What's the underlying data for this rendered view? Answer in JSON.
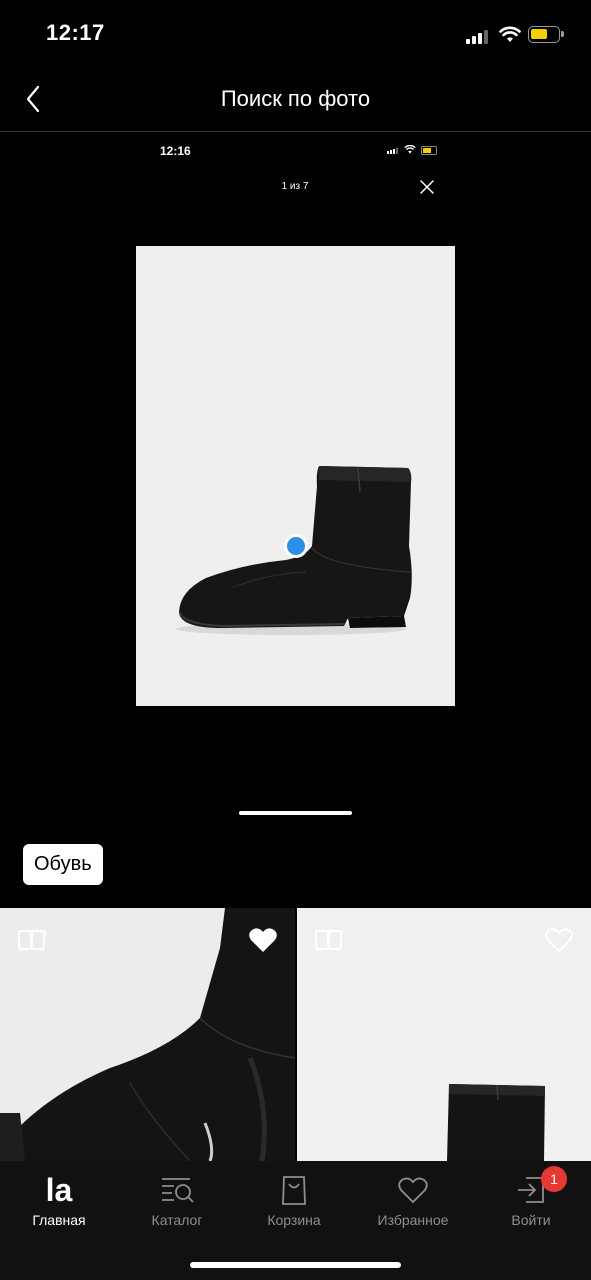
{
  "status_bar": {
    "time": "12:17"
  },
  "header": {
    "title": "Поиск по фото"
  },
  "inner_screen": {
    "time": "12:16",
    "counter": "1 из 7"
  },
  "category_chip": {
    "label": "Обувь"
  },
  "tabs": [
    {
      "label": "Главная",
      "icon": "logo-icon",
      "active": true
    },
    {
      "label": "Каталог",
      "icon": "catalog-search-icon",
      "active": false
    },
    {
      "label": "Корзина",
      "icon": "bag-icon",
      "active": false
    },
    {
      "label": "Избранное",
      "icon": "heart-icon",
      "active": false
    },
    {
      "label": "Войти",
      "icon": "login-icon",
      "active": false
    }
  ],
  "tab_badge": "1",
  "home_logo_text": "la",
  "colors": {
    "accent_dot": "#2e8fe8",
    "badge": "#e53935",
    "battery": "#f5d000"
  }
}
